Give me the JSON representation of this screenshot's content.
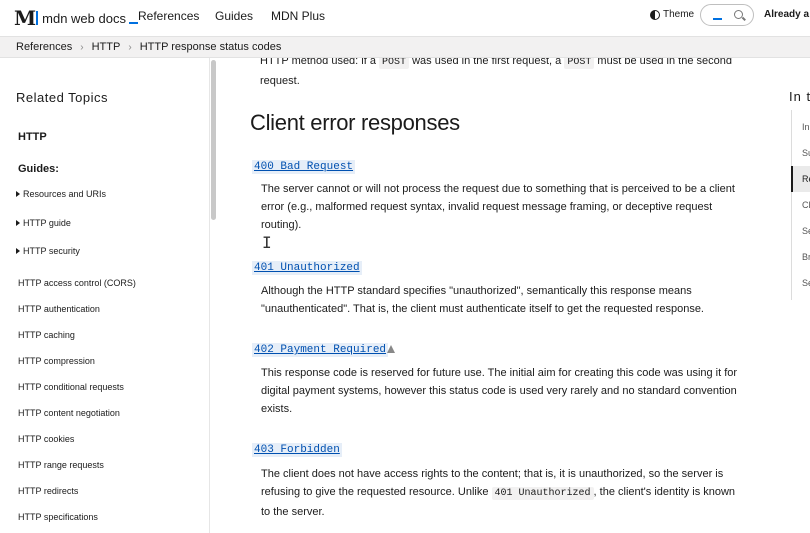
{
  "header": {
    "logo_text": "mdn web docs",
    "nav": [
      "References",
      "Guides",
      "MDN Plus"
    ],
    "theme_label": "Theme",
    "account_text": "Already a s"
  },
  "breadcrumb": [
    "References",
    "HTTP",
    "HTTP response status codes"
  ],
  "sidebar": {
    "title": "Related Topics",
    "section": "HTTP",
    "guides_label": "Guides:",
    "expandable": [
      "Resources and URIs",
      "HTTP guide",
      "HTTP security"
    ],
    "links": [
      "HTTP access control (CORS)",
      "HTTP authentication",
      "HTTP caching",
      "HTTP compression",
      "HTTP conditional requests",
      "HTTP content negotiation",
      "HTTP cookies",
      "HTTP range requests",
      "HTTP redirects",
      "HTTP specifications"
    ]
  },
  "main": {
    "intro": {
      "before": "HTTP method used: if a ",
      "code1": "POST",
      "middle": " was used in the first request, a ",
      "code2": "POST",
      "after": " must be used in the second",
      "line2": "request."
    },
    "heading": "Client error responses",
    "entries": [
      {
        "code": "400 Bad Request",
        "lines": [
          "The server cannot or will not process the request due to something that is perceived to be a client",
          "error (e.g., malformed request syntax, invalid request message framing, or deceptive request",
          "routing)."
        ]
      },
      {
        "code": "401 Unauthorized",
        "lines": [
          "Although the HTTP standard specifies \"unauthorized\", semantically this response means",
          "\"unauthenticated\". That is, the client must authenticate itself to get the requested response."
        ]
      },
      {
        "code": "402 Payment Required",
        "lines": [
          "This response code is reserved for future use. The initial aim for creating this code was using it for",
          "digital payment systems, however this status code is used very rarely and no standard convention",
          "exists."
        ]
      },
      {
        "code": "403 Forbidden",
        "line1": "The client does not have access rights to the content; that is, it is unauthorized, so the server is",
        "line2_before": "refusing to give the requested resource. Unlike ",
        "line2_code": "401 Unauthorized",
        "line2_after": ", the client's identity is known",
        "line3": "to the server."
      }
    ]
  },
  "toc": {
    "title": "In t",
    "items": [
      "In",
      "Su",
      "Re",
      "Cl",
      "Se",
      "Br",
      "Se"
    ]
  }
}
